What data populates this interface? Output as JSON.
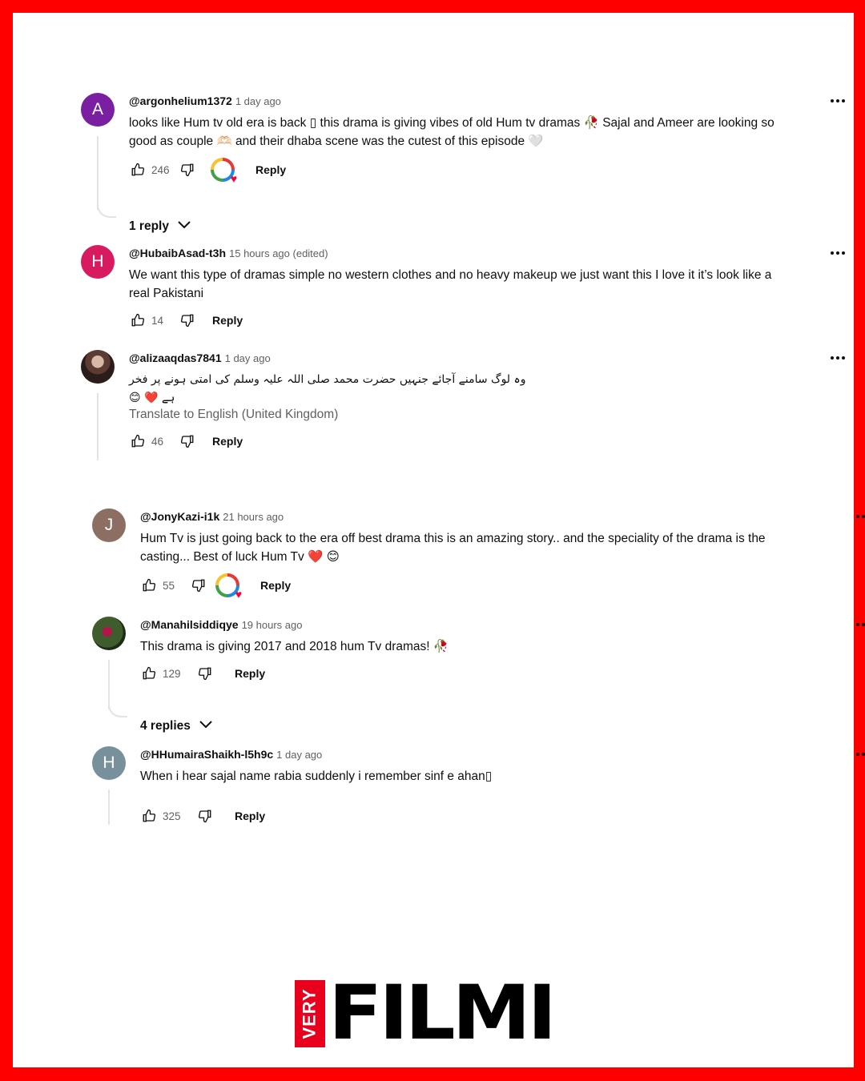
{
  "comments": [
    {
      "author": "@argonhelium1372",
      "time": "1 day ago",
      "avatar_letter": "A",
      "avatar_color": "#7b1fa2",
      "text_line1": "looks like Hum tv old era is  back ▯ this drama is giving vibes of old Hum tv dramas 🥀 Sajal and Ameer are looking so",
      "text_line2": "good as couple 🫶🏻 and their dhaba scene was the cutest of this episode 🤍",
      "likes": "246",
      "reply_label": "Reply",
      "replies_label": "1 reply"
    },
    {
      "author": "@HubaibAsad-t3h",
      "time": "15 hours ago (edited)",
      "avatar_letter": "H",
      "avatar_color": "#d81b60",
      "text_line1": "We want this type of dramas simple no western clothes and no heavy makeup we just want this I love it it’s look like a",
      "text_line2": "real Pakistani",
      "likes": "14",
      "reply_label": "Reply"
    },
    {
      "author": "@alizaaqdas7841",
      "time": "1 day ago",
      "avatar_letter": "",
      "text_line1": "وہ لوگ سامنے آجائے جنہیں حضرت محمد صلی اللہ علیہ وسلم کی امتی ہونے پر فخر ہے ❤️ 😊",
      "translate": "Translate to English (United Kingdom)",
      "likes": "46",
      "reply_label": "Reply"
    },
    {
      "author": "@JonyKazi-i1k",
      "time": "21 hours ago",
      "avatar_letter": "J",
      "avatar_color": "#8d6e63",
      "text_line1": "Hum Tv is just going back to the era off best drama this is an amazing story.. and the speciality of the drama is the",
      "text_line2": "casting... Best of luck Hum Tv ❤️ 😊",
      "likes": "55",
      "reply_label": "Reply"
    },
    {
      "author": "@Manahilsiddiqye",
      "time": "19 hours ago",
      "avatar_letter": "",
      "text_line1": "This drama is giving 2017 and 2018 hum Tv dramas! 🥀",
      "likes": "129",
      "reply_label": "Reply",
      "replies_label": "4 replies"
    },
    {
      "author": "@HHumairaShaikh-l5h9c",
      "time": "1 day ago",
      "avatar_letter": "H",
      "avatar_color": "#78909c",
      "text_line1": "When i hear sajal name rabia suddenly i remember sinf e ahan▯",
      "likes": "325",
      "reply_label": "Reply"
    }
  ],
  "logo": {
    "small": "VERY",
    "main": "FILMI"
  },
  "colors": {
    "frame": "#ff0000",
    "logo_red": "#e8001c"
  }
}
